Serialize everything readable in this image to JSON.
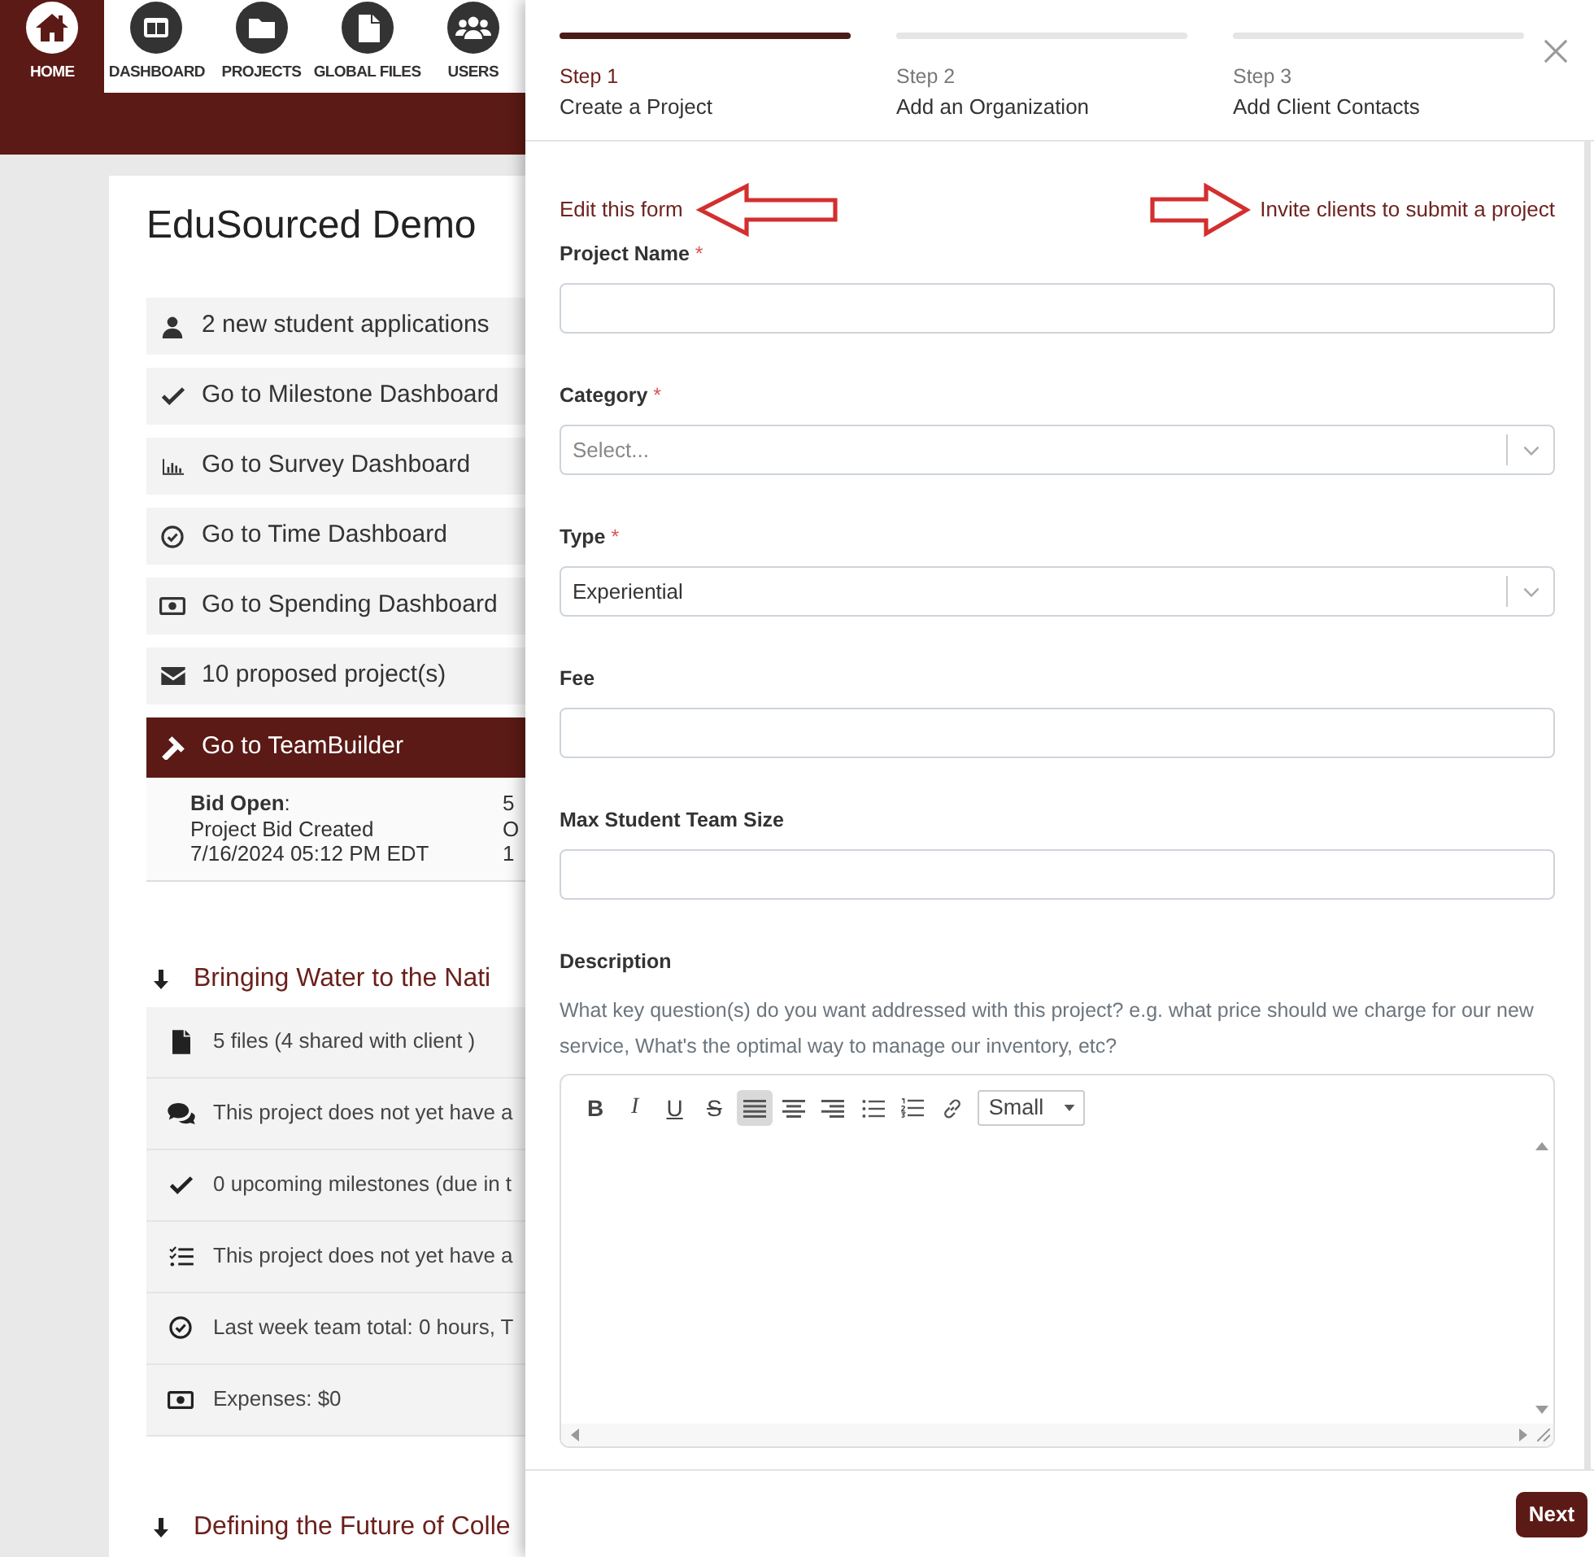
{
  "nav": {
    "items": [
      {
        "label": "HOME",
        "selected": true
      },
      {
        "label": "DASHBOARD",
        "selected": false
      },
      {
        "label": "PROJECTS",
        "selected": false
      },
      {
        "label": "GLOBAL FILES",
        "selected": false
      },
      {
        "label": "USERS",
        "selected": false
      }
    ]
  },
  "panel": {
    "title": "EduSourced Demo",
    "links": [
      {
        "label": "2 new student applications",
        "selected": false
      },
      {
        "label": "Go to Milestone Dashboard",
        "selected": false
      },
      {
        "label": "Go to Survey Dashboard",
        "selected": false
      },
      {
        "label": "Go to Time Dashboard",
        "selected": false
      },
      {
        "label": "Go to Spending Dashboard",
        "selected": false
      },
      {
        "label": "10 proposed project(s)",
        "selected": false
      },
      {
        "label": "Go to TeamBuilder",
        "selected": true
      }
    ],
    "bid": {
      "lines": [
        "**Bid Open**:",
        "Project Bid Created",
        "7/16/2024 05:12 PM EDT"
      ],
      "column_2": [
        "5",
        "O",
        "1"
      ]
    }
  },
  "projects": [
    {
      "title": "Bringing Water to the Nati",
      "items": [
        "5 files (4 shared with client )",
        "This project does not yet have a",
        "0 upcoming milestones (due in t",
        "This project does not yet have a",
        "Last week team total: 0 hours, T",
        "Expenses: $0"
      ]
    },
    {
      "title": "Defining the Future of Colle"
    }
  ],
  "wizard": {
    "steps": [
      {
        "label": "Step 1",
        "title": "Create a Project",
        "selected": true
      },
      {
        "label": "Step 2",
        "title": "Add an Organization",
        "selected": false
      },
      {
        "label": "Step 3",
        "title": "Add Client Contacts",
        "selected": false
      }
    ],
    "edit_link": "Edit this form",
    "invite_link": "Invite clients to submit a project",
    "fields": [
      {
        "kind": "text",
        "label": "Project Name",
        "asterisk": "*"
      },
      {
        "kind": "select",
        "label": "Category",
        "asterisk": "*",
        "placeholder": "Select..."
      },
      {
        "kind": "select",
        "label": "Type",
        "asterisk": "*",
        "value": "Experiential"
      },
      {
        "kind": "text",
        "label": "Fee"
      },
      {
        "kind": "text",
        "label": "Max Student Team Size"
      }
    ],
    "description": {
      "label": "Description",
      "hint": "What key question(s) do you want addressed with this project? e.g. what price should we charge for our new service, What's the optimal way to manage our inventory, etc?",
      "toolbar": [
        {
          "kind": "bold",
          "label": "B",
          "selected": false
        },
        {
          "kind": "italic",
          "label": "I",
          "selected": false
        },
        {
          "kind": "underline",
          "label": "U",
          "selected": false
        },
        {
          "kind": "strike",
          "label": "S",
          "selected": false
        },
        {
          "kind": "justify",
          "selected": true
        },
        {
          "kind": "center",
          "selected": false
        },
        {
          "kind": "right",
          "selected": false
        },
        {
          "kind": "bullets",
          "selected": false
        },
        {
          "kind": "numbers",
          "selected": false
        },
        {
          "kind": "link",
          "selected": false
        }
      ],
      "size": "Small"
    },
    "next_button": "Next"
  }
}
